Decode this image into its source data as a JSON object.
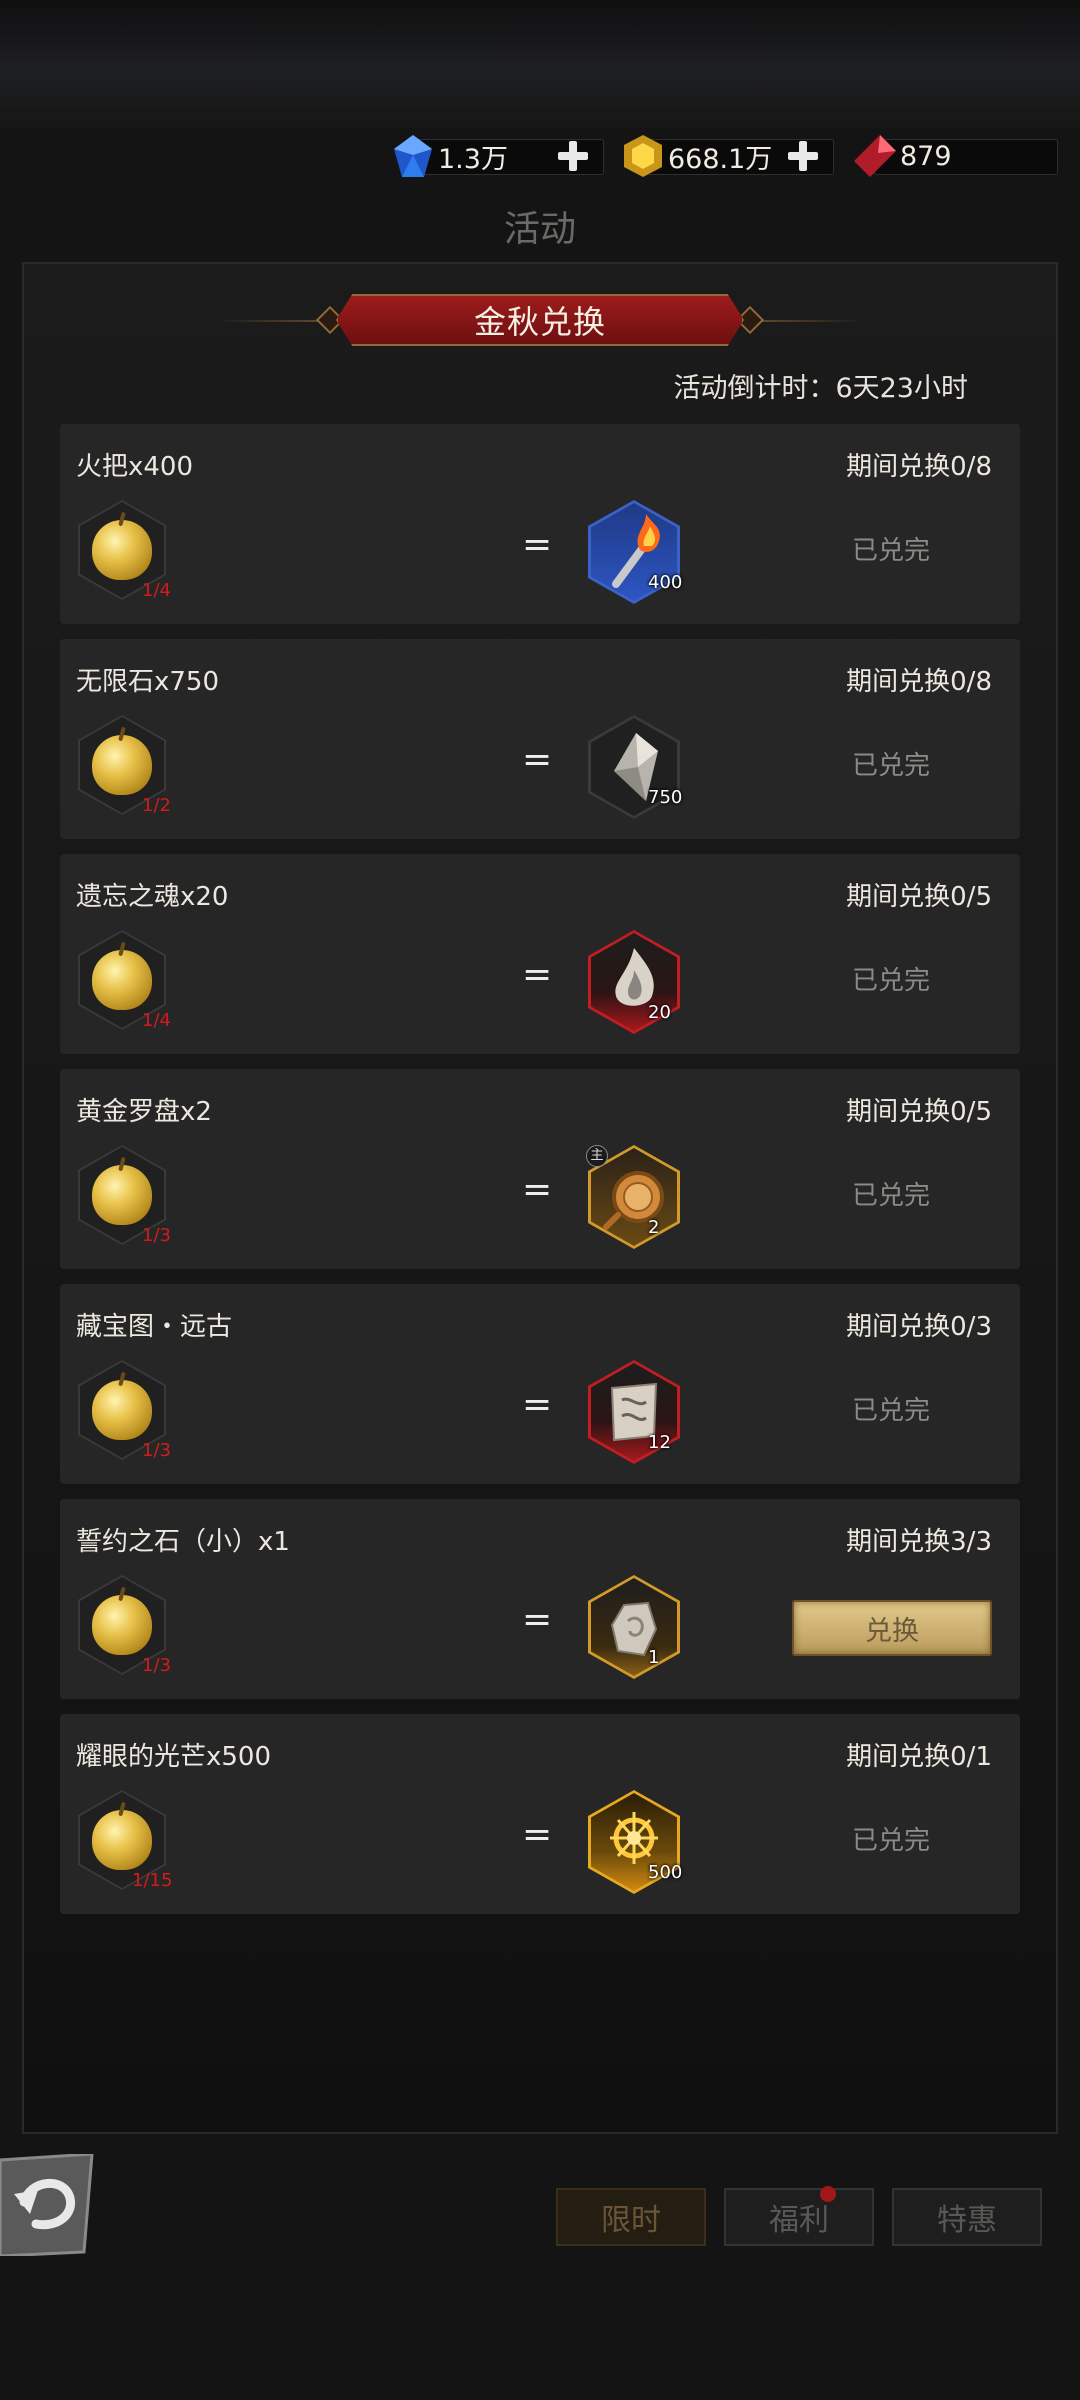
{
  "currencies": [
    {
      "icon": "blue-diamond-icon",
      "value": "1.3万",
      "color": "#2a6fe8"
    },
    {
      "icon": "gold-coin-icon",
      "value": "668.1万",
      "color": "#e2b52a"
    },
    {
      "icon": "red-gem-icon",
      "value": "879",
      "color": "#d12a3a"
    }
  ],
  "screen_title": "活动",
  "event": {
    "title": "金秋兑换",
    "countdown": "活动倒计时：6天23小时"
  },
  "rows": [
    {
      "name": "火把x400",
      "limit": "期间兑换0/8",
      "cost_icon": "golden-apple-icon",
      "cost_count": "1/4",
      "equals": "=",
      "reward_icon": "torch-icon",
      "reward_count": "400",
      "status": "已兑完"
    },
    {
      "name": "无限石x750",
      "limit": "期间兑换0/8",
      "cost_icon": "golden-apple-icon",
      "cost_count": "1/2",
      "equals": "=",
      "reward_icon": "crystal-icon",
      "reward_count": "750",
      "status": "已兑完"
    },
    {
      "name": "遗忘之魂x20",
      "limit": "期间兑换0/5",
      "cost_icon": "golden-apple-icon",
      "cost_count": "1/4",
      "equals": "=",
      "reward_icon": "soul-flame-icon",
      "reward_count": "20",
      "status": "已兑完"
    },
    {
      "name": "黄金罗盘x2",
      "limit": "期间兑换0/5",
      "cost_icon": "golden-apple-icon",
      "cost_count": "1/3",
      "equals": "=",
      "reward_icon": "compass-icon",
      "reward_badge": "主",
      "reward_count": "2",
      "status": "已兑完"
    },
    {
      "name": "藏宝图・远古",
      "limit": "期间兑换0/3",
      "cost_icon": "golden-apple-icon",
      "cost_count": "1/3",
      "equals": "=",
      "reward_icon": "treasure-map-icon",
      "reward_count": "12",
      "status": "已兑完"
    },
    {
      "name": "誓约之石（小）x1",
      "limit": "期间兑换3/3",
      "cost_icon": "golden-apple-icon",
      "cost_count": "1/3",
      "equals": "=",
      "reward_icon": "oath-stone-icon",
      "reward_count": "1",
      "button": "兑换"
    },
    {
      "name": "耀眼的光芒x500",
      "limit": "期间兑换0/1",
      "cost_icon": "golden-apple-icon",
      "cost_count": "1/15",
      "equals": "=",
      "reward_icon": "radiance-emblem-icon",
      "reward_count": "500",
      "status": "已兑完"
    }
  ],
  "bottom": {
    "back_icon": "back-arrow-icon",
    "tabs": [
      "限时",
      "福利",
      "特惠"
    ]
  }
}
